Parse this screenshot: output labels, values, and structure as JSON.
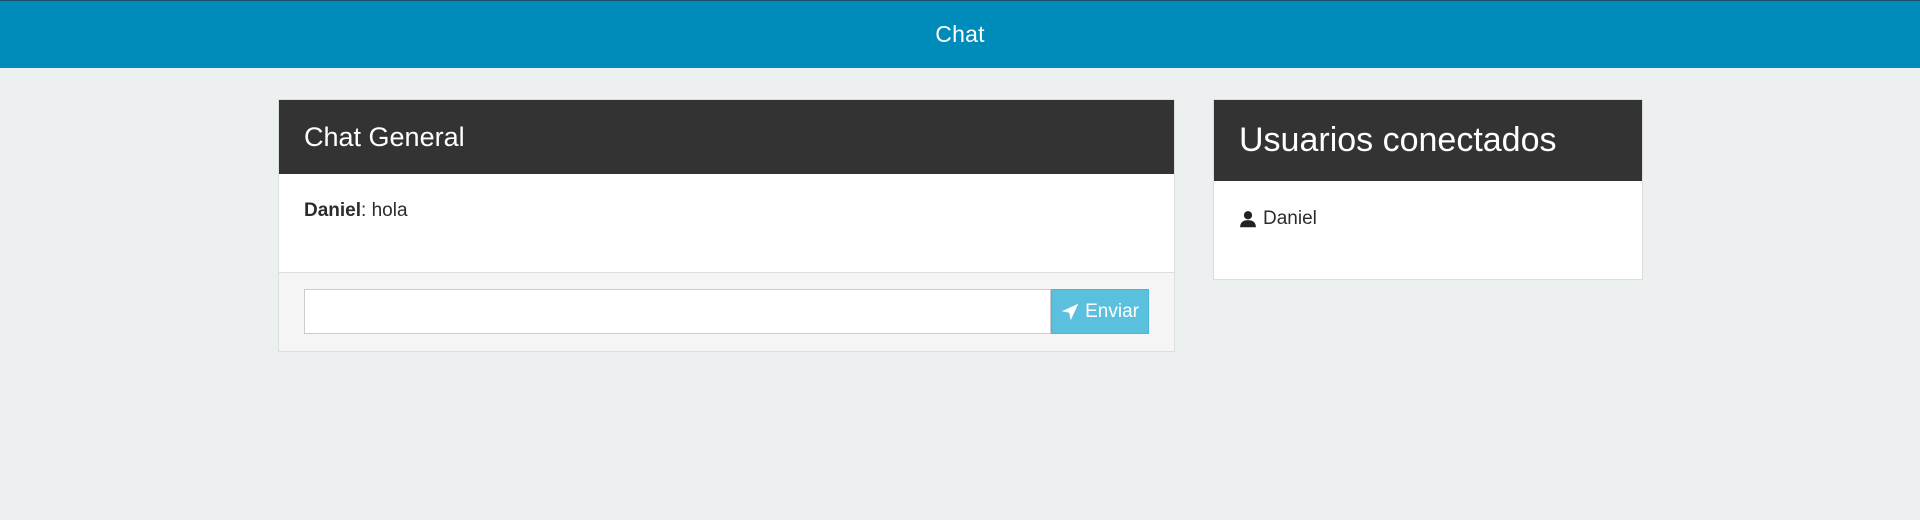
{
  "header": {
    "title": "Chat"
  },
  "chat": {
    "title": "Chat General",
    "messages": [
      {
        "user": "Daniel",
        "separator": ":",
        "text": " hola"
      }
    ],
    "input": {
      "value": "",
      "placeholder": ""
    },
    "send_label": "Enviar",
    "send_icon": "paper-plane-icon"
  },
  "users": {
    "title": "Usuarios conectados",
    "list": [
      {
        "name": "Daniel",
        "icon": "user-icon"
      }
    ]
  },
  "colors": {
    "topbar": "#008cba",
    "panel_heading": "#333333",
    "send_button": "#5bc0de",
    "background": "#ecf0f1"
  }
}
